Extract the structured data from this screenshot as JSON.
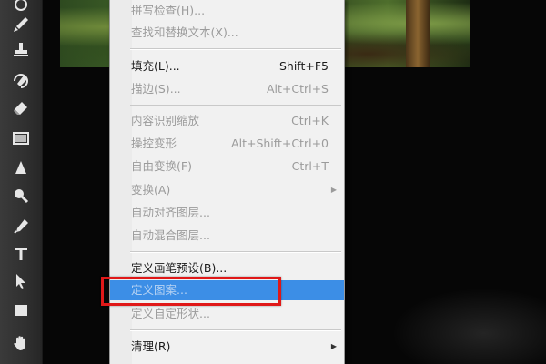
{
  "menu": {
    "items": [
      {
        "label": "拼写检查(H)...",
        "shortcut": "",
        "disabled": true
      },
      {
        "label": "查找和替换文本(X)...",
        "shortcut": "",
        "disabled": true
      },
      {
        "label": "填充(L)...",
        "shortcut": "Shift+F5",
        "disabled": false
      },
      {
        "label": "描边(S)...",
        "shortcut": "Alt+Ctrl+S",
        "disabled": true
      },
      {
        "label": "内容识别缩放",
        "shortcut": "Ctrl+K",
        "disabled": true
      },
      {
        "label": "操控变形",
        "shortcut": "Alt+Shift+Ctrl+0",
        "disabled": true
      },
      {
        "label": "自由变换(F)",
        "shortcut": "Ctrl+T",
        "disabled": true
      },
      {
        "label": "变换(A)",
        "shortcut": "",
        "disabled": true,
        "submenu": true
      },
      {
        "label": "自动对齐图层...",
        "shortcut": "",
        "disabled": true
      },
      {
        "label": "自动混合图层...",
        "shortcut": "",
        "disabled": true
      },
      {
        "label": "定义画笔预设(B)...",
        "shortcut": "",
        "disabled": false
      },
      {
        "label": "定义图案...",
        "shortcut": "",
        "disabled": false,
        "highlighted": true
      },
      {
        "label": "定义自定形状...",
        "shortcut": "",
        "disabled": true
      },
      {
        "label": "清理(R)",
        "shortcut": "",
        "disabled": false,
        "submenu": true
      }
    ]
  },
  "toolbar": {
    "tools": [
      "eraser-icon",
      "brush-icon",
      "clone-stamp-icon",
      "history-brush-icon",
      "eraser-block-icon",
      "gradient-icon",
      "blur-icon",
      "dodge-icon",
      "pen-icon",
      "type-icon",
      "path-selection-icon",
      "rectangle-shape-icon",
      "hand-icon"
    ]
  },
  "colors": {
    "menu_bg": "#f1f1f1",
    "highlight": "#3c8ee6",
    "annotation": "#e01818",
    "disabled_text": "#9b9b9b"
  }
}
